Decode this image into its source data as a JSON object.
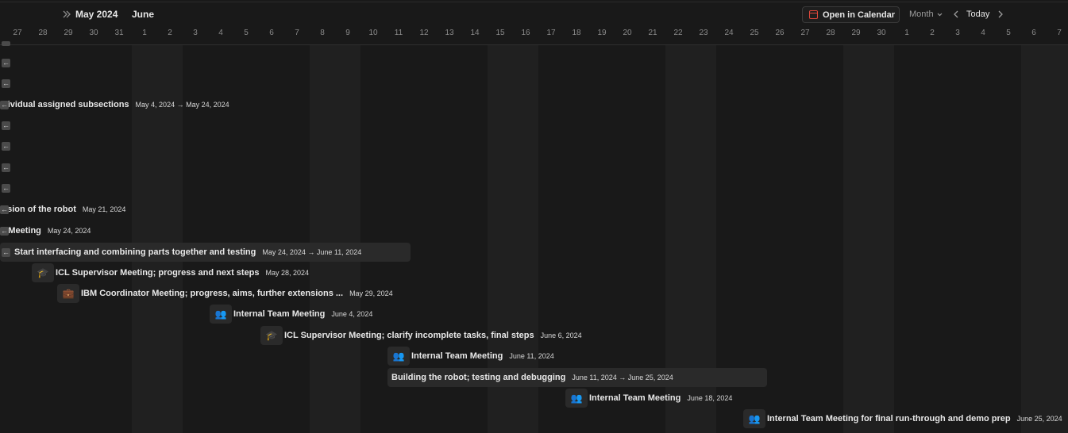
{
  "header": {
    "month_current": "May 2024",
    "month_next": "June",
    "open_in_calendar": "Open in Calendar",
    "view_mode": "Month",
    "today": "Today"
  },
  "days": [
    "27",
    "28",
    "29",
    "30",
    "31",
    "1",
    "2",
    "3",
    "4",
    "5",
    "6",
    "7",
    "8",
    "9",
    "10",
    "11",
    "12",
    "13",
    "14",
    "15",
    "16",
    "17",
    "18",
    "19",
    "20",
    "21",
    "22",
    "23",
    "24",
    "25",
    "26",
    "27",
    "28",
    "29",
    "30",
    "1",
    "2",
    "3",
    "4",
    "5",
    "6",
    "7"
  ],
  "events": [
    {
      "title": "dividual assigned subsections",
      "date": "May 4, 2024 → May 24, 2024"
    },
    {
      "title": "ssion of the robot",
      "date": "May 21, 2024"
    },
    {
      "title": "r Meeting",
      "date": "May 24, 2024"
    },
    {
      "title": "Start interfacing and combining parts together and testing",
      "date": "May 24, 2024 → June 11, 2024"
    },
    {
      "title": "ICL Supervisor Meeting; progress and next steps",
      "date": "May 28, 2024",
      "icon": "graduation-cap-icon"
    },
    {
      "title": "IBM Coordinator Meeting; progress, aims, further extensions ...",
      "date": "May 29, 2024",
      "icon": "briefcase-icon"
    },
    {
      "title": "Internal Team Meeting",
      "date": "June 4, 2024",
      "icon": "people-icon"
    },
    {
      "title": "ICL Supervisor Meeting; clarify incomplete tasks, final steps",
      "date": "June 6, 2024",
      "icon": "graduation-cap-icon"
    },
    {
      "title": "Internal Team Meeting",
      "date": "June 11, 2024",
      "icon": "people-icon"
    },
    {
      "title": "Building the robot; testing and debugging",
      "date": "June 11, 2024 → June 25, 2024"
    },
    {
      "title": "Internal Team Meeting",
      "date": "June 18, 2024",
      "icon": "people-icon"
    },
    {
      "title": "Internal Team Meeting for final run-through and demo prep",
      "date": "June 25, 2024",
      "icon": "people-icon"
    }
  ],
  "colors": {
    "background": "#191919",
    "weekend": "#202020",
    "card": "#2a2a2a",
    "calendar_icon": "#e0483b",
    "people_icon": "#c98b6a",
    "graduation_icon": "#2ea67a",
    "briefcase_icon": "#3a7fd5"
  }
}
